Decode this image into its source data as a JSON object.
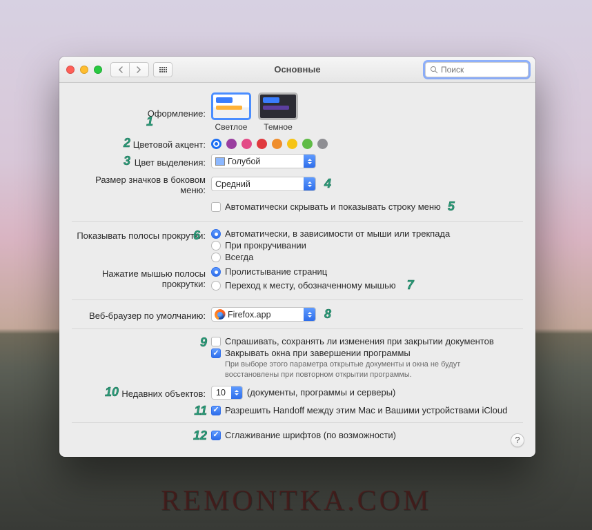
{
  "window": {
    "title": "Основные"
  },
  "search": {
    "placeholder": "Поиск"
  },
  "labels": {
    "appearance": "Оформление:",
    "accent": "Цветовой акцент:",
    "highlight": "Цвет выделения:",
    "sidebar_icon_size": "Размер значков в боковом меню:",
    "scrollbars": "Показывать полосы прокрутки:",
    "scroll_click": "Нажатие мышью полосы прокрутки:",
    "browser": "Веб-браузер по умолчанию:",
    "recent": "Недавних объектов:"
  },
  "appearance": {
    "light": "Светлое",
    "dark": "Темное"
  },
  "accent_colors": [
    "#1b6ef3",
    "#9a3ea0",
    "#e34b87",
    "#e0393e",
    "#ef8e2d",
    "#f6c415",
    "#5fbb46",
    "#8e8e93"
  ],
  "accent_selected_index": 0,
  "highlight": {
    "value": "Голубой"
  },
  "sidebar_size": {
    "value": "Средний"
  },
  "auto_hide_menubar": {
    "checked": false,
    "label": "Автоматически скрывать и показывать строку меню"
  },
  "scrollbars": {
    "opt1": "Автоматически, в зависимости от мыши или трекпада",
    "opt2": "При прокручивании",
    "opt3": "Всегда",
    "selected": 0
  },
  "scroll_click": {
    "opt1": "Пролистывание страниц",
    "opt2": "Переход к месту, обозначенному мышью",
    "selected": 0
  },
  "browser": {
    "value": "Firefox.app"
  },
  "ask_save": {
    "checked": false,
    "label": "Спрашивать, сохранять ли изменения при закрытии документов"
  },
  "close_windows": {
    "checked": true,
    "label": "Закрывать окна при завершении программы",
    "note": "При выборе этого параметра открытые документы и окна не будут восстановлены при повторном открытии программы."
  },
  "recent": {
    "value": "10",
    "suffix": "(документы, программы и серверы)"
  },
  "handoff": {
    "checked": true,
    "label": "Разрешить Handoff между этим Mac и Вашими устройствами iCloud"
  },
  "font_smoothing": {
    "checked": true,
    "label": "Сглаживание шрифтов (по возможности)"
  },
  "badges": [
    "1",
    "2",
    "3",
    "4",
    "5",
    "6",
    "7",
    "8",
    "9",
    "10",
    "11",
    "12"
  ],
  "watermark": "REMONTKA.COM"
}
